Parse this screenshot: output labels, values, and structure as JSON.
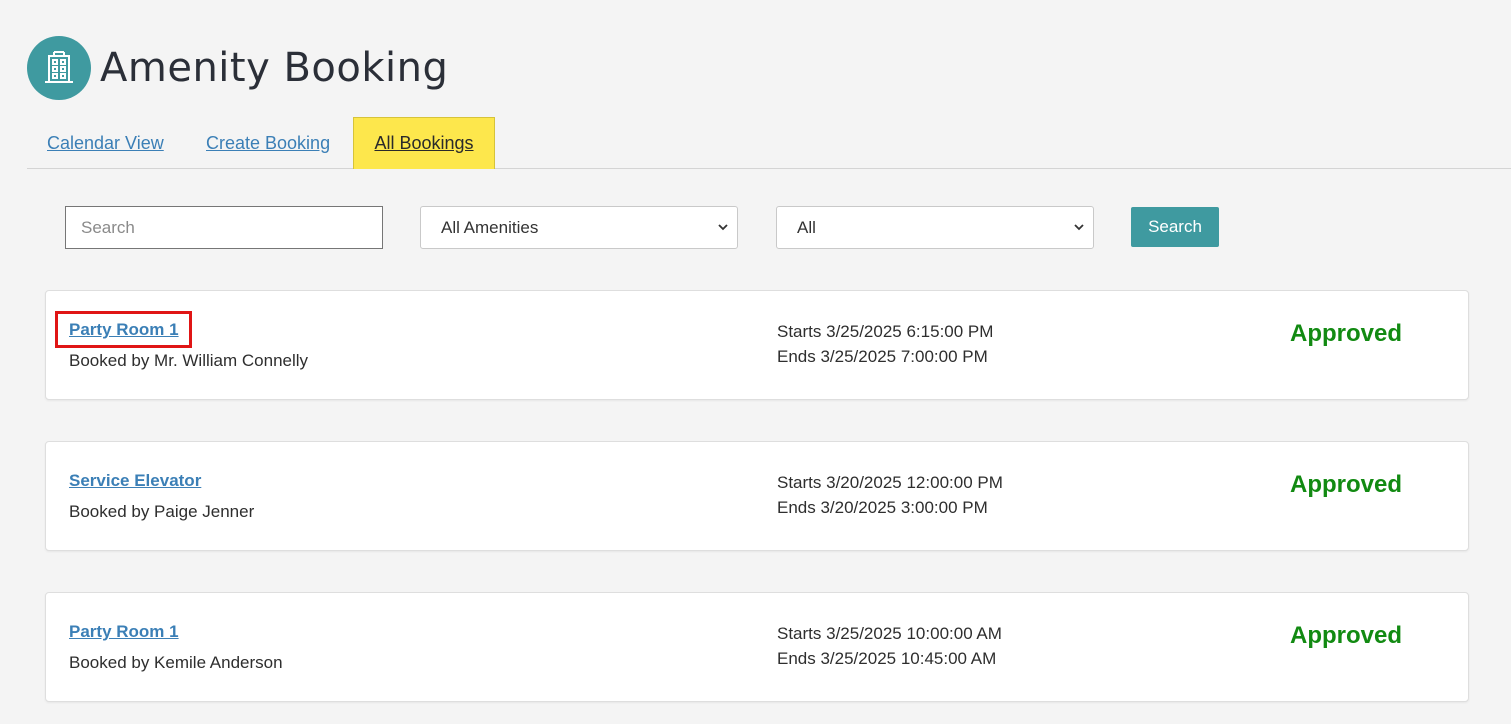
{
  "app": {
    "title": "Amenity Booking",
    "logo_icon": "building-icon",
    "accent": "#3f9aa0"
  },
  "tabs": [
    {
      "label": "Calendar View",
      "active": false
    },
    {
      "label": "Create Booking",
      "active": false
    },
    {
      "label": "All Bookings",
      "active": true
    }
  ],
  "filters": {
    "search_placeholder": "Search",
    "amenity_selected": "All Amenities",
    "status_selected": "All",
    "search_button": "Search"
  },
  "bookings": [
    {
      "amenity": "Party Room 1",
      "booked_by": "Booked by Mr. William Connelly",
      "starts": "Starts 3/25/2025 6:15:00 PM",
      "ends": "Ends 3/25/2025 7:00:00 PM",
      "status": "Approved"
    },
    {
      "amenity": "Service Elevator",
      "booked_by": "Booked by Paige Jenner",
      "starts": "Starts 3/20/2025 12:00:00 PM",
      "ends": "Ends 3/20/2025 3:00:00 PM",
      "status": "Approved"
    },
    {
      "amenity": "Party Room 1",
      "booked_by": "Booked by Kemile Anderson",
      "starts": "Starts 3/25/2025 10:00:00 AM",
      "ends": "Ends 3/25/2025 10:45:00 AM",
      "status": "Approved"
    }
  ],
  "colors": {
    "status_approved": "#128a12",
    "tab_active_bg": "#fde74c",
    "link": "#3b7fb6",
    "highlight": "#e01515"
  }
}
